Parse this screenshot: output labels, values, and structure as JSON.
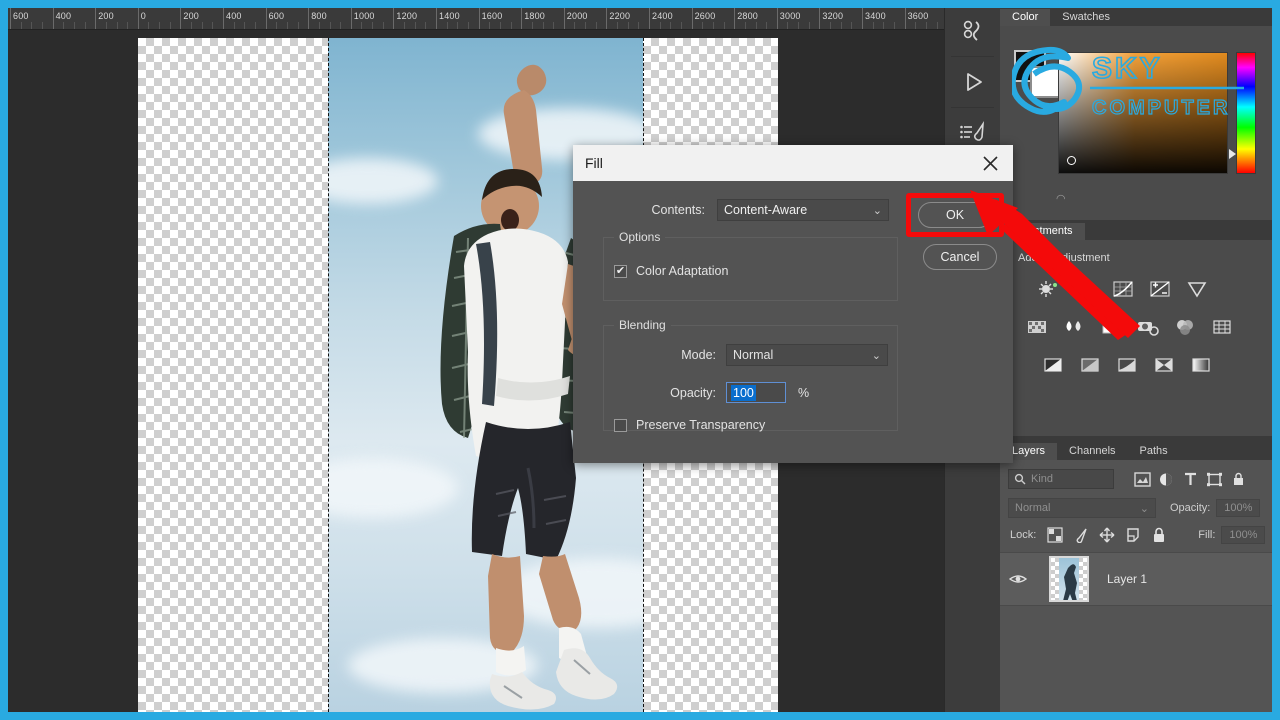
{
  "app": {
    "name": "Adobe Photoshop",
    "theme_bg": "#323232",
    "frame_color": "#29aae1"
  },
  "ruler": {
    "unit": "px",
    "labels": [
      "600",
      "400",
      "200",
      "0",
      "200",
      "400",
      "600",
      "800",
      "1000",
      "1200",
      "1400",
      "1600",
      "1800",
      "2000",
      "2200",
      "2400",
      "2600",
      "2800",
      "3000",
      "3200",
      "3400",
      "3600"
    ]
  },
  "canvas": {
    "layer_transparency": "checkerboard",
    "selection": "marching-ants",
    "photo_description": "man jumping with raised fist in front of sky"
  },
  "icon_dock": {
    "items": [
      {
        "name": "histogram-icon",
        "label": "Histogram"
      },
      {
        "name": "actions-play-icon",
        "label": "Actions"
      },
      {
        "name": "brush-presets-icon",
        "label": "Brush Presets"
      }
    ]
  },
  "color_panel": {
    "tabs": [
      {
        "label": "Color",
        "active": true
      },
      {
        "label": "Swatches",
        "active": false
      }
    ],
    "foreground": "#111111",
    "background": "#ffffff"
  },
  "watermark": {
    "line1": "SKY",
    "line2": "COMPUTER",
    "color": "#29aae1"
  },
  "adjustments_panel": {
    "tabs": [
      {
        "label": "Adjustments",
        "active": true
      }
    ],
    "hint": "Add an adjustment",
    "rows": [
      [
        "brightness-contrast-icon",
        "levels-icon",
        "curves-icon",
        "exposure-icon",
        "vibrance-icon"
      ],
      [
        "hue-saturation-icon",
        "color-balance-icon",
        "black-white-icon",
        "photo-filter-icon",
        "channel-mixer-icon",
        "color-lookup-icon"
      ],
      [
        "invert-icon",
        "posterize-icon",
        "threshold-icon",
        "selective-color-icon",
        "gradient-map-icon"
      ]
    ]
  },
  "layers_panel": {
    "tabs": [
      {
        "label": "Layers",
        "active": true
      },
      {
        "label": "Channels",
        "active": false
      },
      {
        "label": "Paths",
        "active": false
      }
    ],
    "filter": {
      "search_icon": "search-icon",
      "kind_label": "Kind",
      "filter_icons": [
        "pixel-filter-icon",
        "adjustment-filter-icon",
        "type-filter-icon",
        "shape-filter-icon",
        "smart-object-filter-icon"
      ]
    },
    "blend_mode": "Normal",
    "opacity_label": "Opacity:",
    "opacity_value": "100%",
    "lock_label": "Lock:",
    "lock_icons": [
      "lock-transparent-pixels-icon",
      "lock-image-pixels-icon",
      "lock-position-icon",
      "lock-artboard-icon",
      "lock-all-icon"
    ],
    "fill_label": "Fill:",
    "fill_value": "100%",
    "layers": [
      {
        "name": "Layer 1",
        "visible": true,
        "visibility_icon": "eye-icon",
        "selected": true
      }
    ]
  },
  "fill_dialog": {
    "title": "Fill",
    "close_icon": "close-icon",
    "contents_label": "Contents:",
    "contents_value": "Content-Aware",
    "dropdown_icon": "chevron-down-icon",
    "options_legend": "Options",
    "color_adaptation_label": "Color Adaptation",
    "color_adaptation_checked": true,
    "blending_legend": "Blending",
    "mode_label": "Mode:",
    "mode_value": "Normal",
    "opacity_label": "Opacity:",
    "opacity_value": "100",
    "percent_sign": "%",
    "preserve_label": "Preserve Transparency",
    "preserve_checked": false,
    "ok_label": "OK",
    "cancel_label": "Cancel",
    "highlight_color": "#f40a0a"
  },
  "annotation": {
    "type": "red-arrow",
    "points_to": "OK",
    "color": "#f40a0a"
  }
}
